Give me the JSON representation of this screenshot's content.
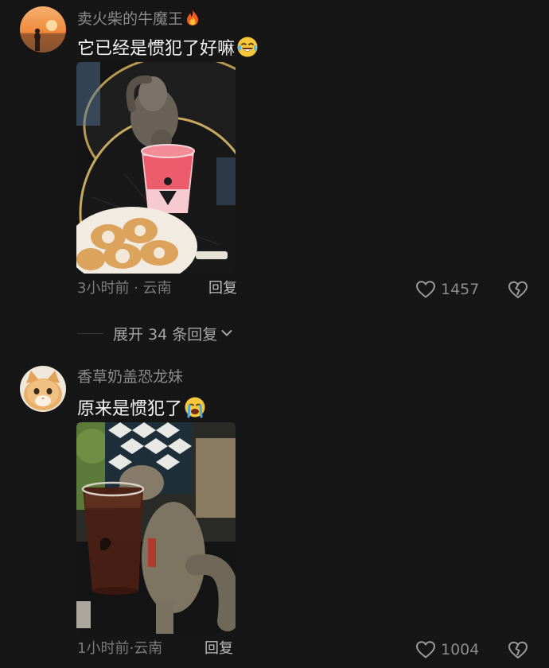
{
  "comments": [
    {
      "username": "卖火柴的牛魔王",
      "username_emoji": "fire",
      "text": "它已经是惯犯了好嘛",
      "text_emoji": "crying-laughing",
      "time": "3小时前",
      "location": "云南",
      "meta_separator": " · ",
      "reply_label": "回复",
      "likes": "1457",
      "avatar": "sunset-silhouette",
      "photo": "squirrel-drinking-pink-drink"
    },
    {
      "username": "香草奶盖恐龙妹",
      "text": "原来是惯犯了",
      "text_emoji": "crying",
      "time": "1小时前",
      "location": "云南",
      "meta_separator": "·",
      "reply_label": "回复",
      "likes": "1004",
      "avatar": "orange-kitten",
      "photo": "squirrel-drinking-iced-tea"
    }
  ],
  "expand_replies": {
    "label": "展开 34 条回复"
  },
  "colors": {
    "background": "#161616",
    "username": "#8c8c8c",
    "text": "#f2f2f2",
    "meta": "#7b7b7b"
  }
}
